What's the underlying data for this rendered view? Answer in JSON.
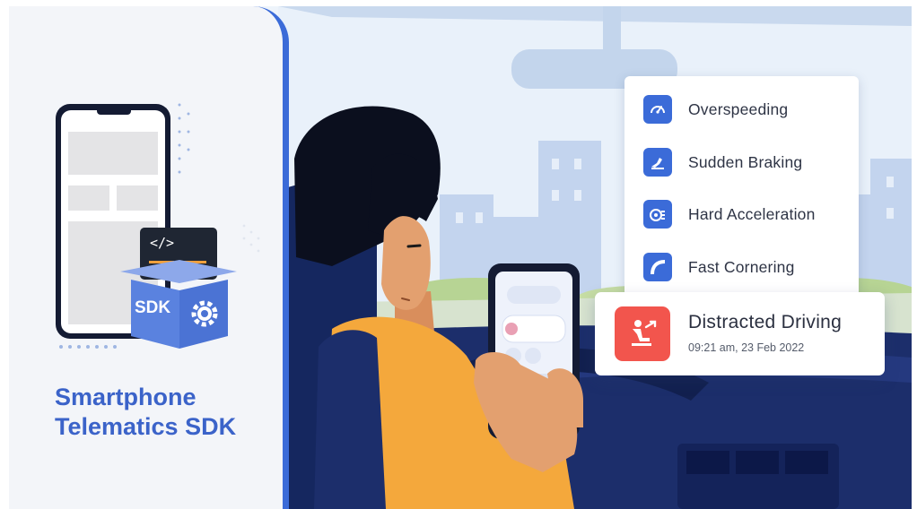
{
  "title_lines": [
    "Smartphone",
    "Telematics SDK"
  ],
  "sdk_box": {
    "label": "SDK",
    "code_glyph": "</>"
  },
  "events": [
    {
      "label": "Overspeeding",
      "icon": "speedometer-icon"
    },
    {
      "label": "Sudden Braking",
      "icon": "braking-icon"
    },
    {
      "label": "Hard Acceleration",
      "icon": "acceleration-icon"
    },
    {
      "label": "Fast Cornering",
      "icon": "cornering-icon"
    }
  ],
  "alert": {
    "title": "Distracted Driving",
    "timestamp": "09:21 am, 23 Feb 2022",
    "icon": "distracted-driver-icon"
  },
  "colors": {
    "brand_blue": "#3b6bd8",
    "title_blue": "#3b63c9",
    "alert_red": "#f2554d",
    "navy": "#1c2e6b",
    "jacket_orange": "#f4a83c"
  }
}
